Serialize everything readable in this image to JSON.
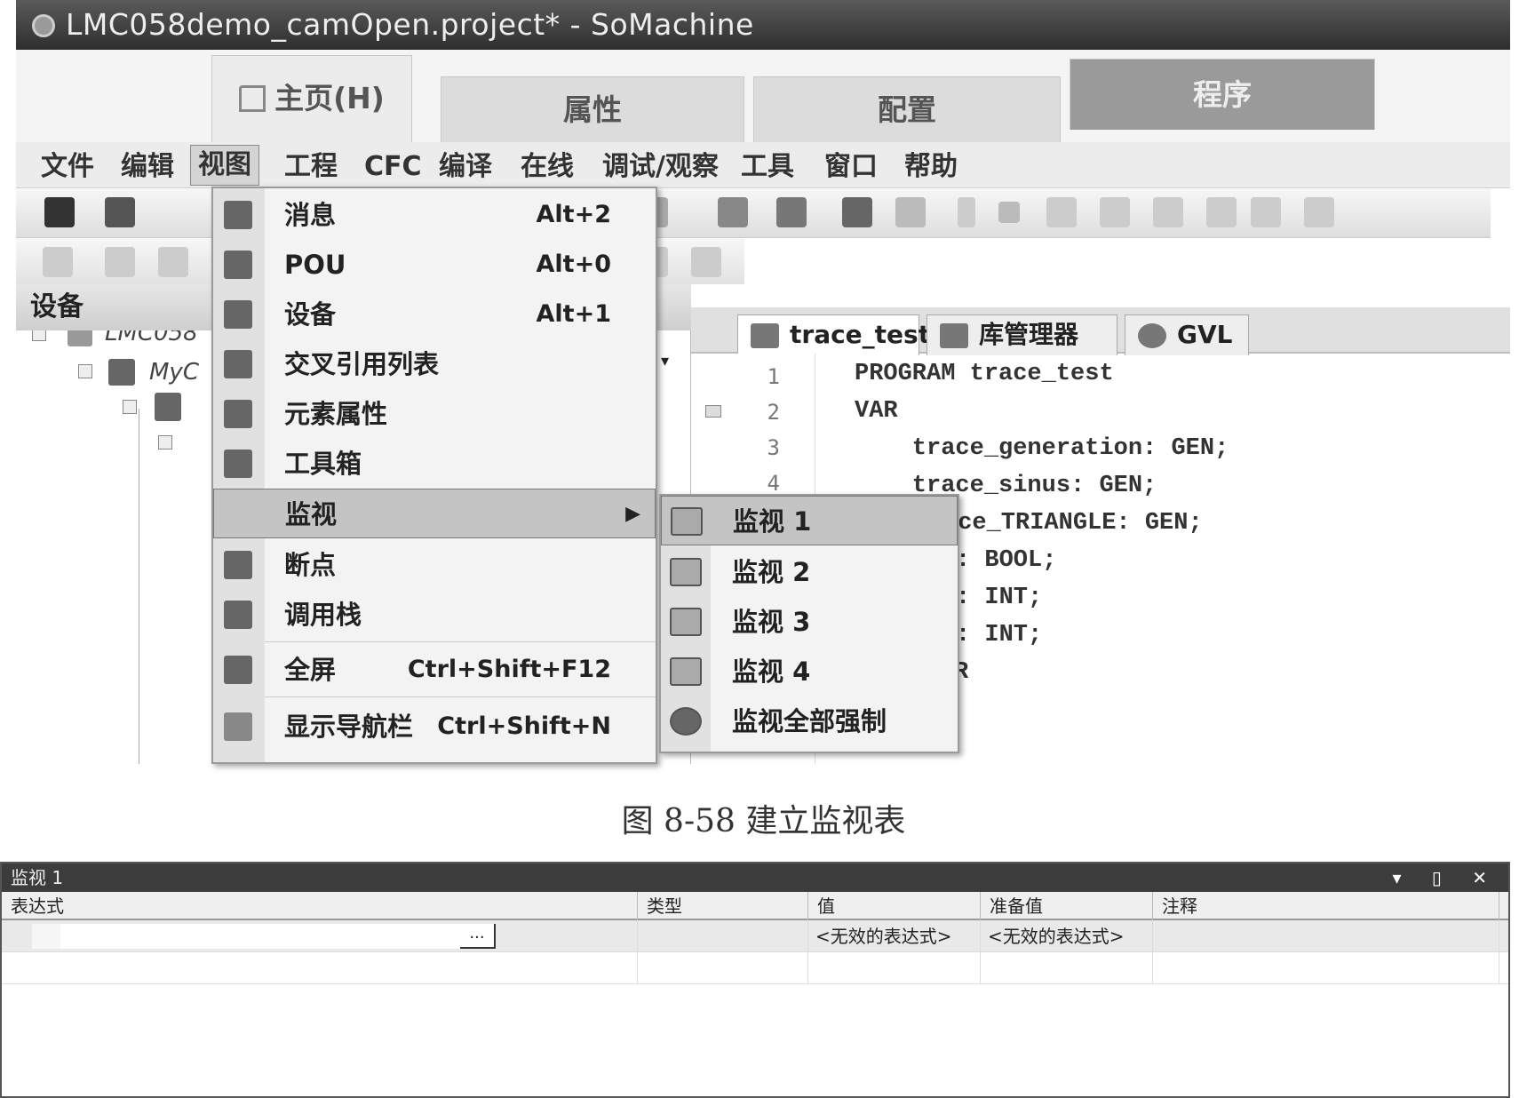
{
  "window": {
    "title": "LMC058demo_camOpen.project* - SoMachine"
  },
  "ribbon_tabs": [
    "主页(H)",
    "属性",
    "配置",
    "程序"
  ],
  "menubar": [
    "文件",
    "编辑",
    "视图",
    "工程",
    "CFC",
    "编译",
    "在线",
    "调试/观察",
    "工具",
    "窗口",
    "帮助"
  ],
  "left_pane": {
    "title": "设备",
    "tree": [
      "LMC058",
      "MyC"
    ]
  },
  "editor_tabs": [
    "trace_test",
    "库管理器",
    "GVL"
  ],
  "code": {
    "line_numbers": [
      "1",
      "2",
      "3",
      "4"
    ],
    "lines": [
      "PROGRAM trace_test",
      "VAR",
      "    trace_generation: GEN;",
      "    trace_sinus: GEN;",
      "ace_TRIANGLE: GEN;",
      ": BOOL;",
      ": INT;",
      ": INT;",
      "R"
    ]
  },
  "view_menu": {
    "items": [
      {
        "icon": "message-icon",
        "label": "消息",
        "shortcut": "Alt+2"
      },
      {
        "icon": "pou-icon",
        "label": "POU",
        "shortcut": "Alt+0"
      },
      {
        "icon": "device-icon",
        "label": "设备",
        "shortcut": "Alt+1"
      },
      {
        "icon": "crossref-icon",
        "label": "交叉引用列表",
        "shortcut": ""
      },
      {
        "icon": "properties-icon",
        "label": "元素属性",
        "shortcut": ""
      },
      {
        "icon": "toolbox-icon",
        "label": "工具箱",
        "shortcut": ""
      },
      {
        "icon": "watch-icon",
        "label": "监视",
        "shortcut": ""
      },
      {
        "icon": "breakpoint-icon",
        "label": "断点",
        "shortcut": ""
      },
      {
        "icon": "callstack-icon",
        "label": "调用栈",
        "shortcut": ""
      },
      {
        "icon": "fullscreen-icon",
        "label": "全屏",
        "shortcut": "Ctrl+Shift+F12"
      },
      {
        "icon": "navbar-icon",
        "label": "显示导航栏",
        "shortcut": "Ctrl+Shift+N"
      }
    ]
  },
  "watch_submenu": [
    "监视 1",
    "监视 2",
    "监视 3",
    "监视 4",
    "监视全部强制"
  ],
  "caption": "图 8-58    建立监视表",
  "watch_window": {
    "title": "监视 1",
    "controls": "▾ ▯ ✕",
    "columns": [
      "表达式",
      "类型",
      "值",
      "准备值",
      "注释"
    ],
    "row": {
      "expression_button": "...",
      "value": "<无效的表达式>",
      "prepared": "<无效的表达式>"
    }
  }
}
